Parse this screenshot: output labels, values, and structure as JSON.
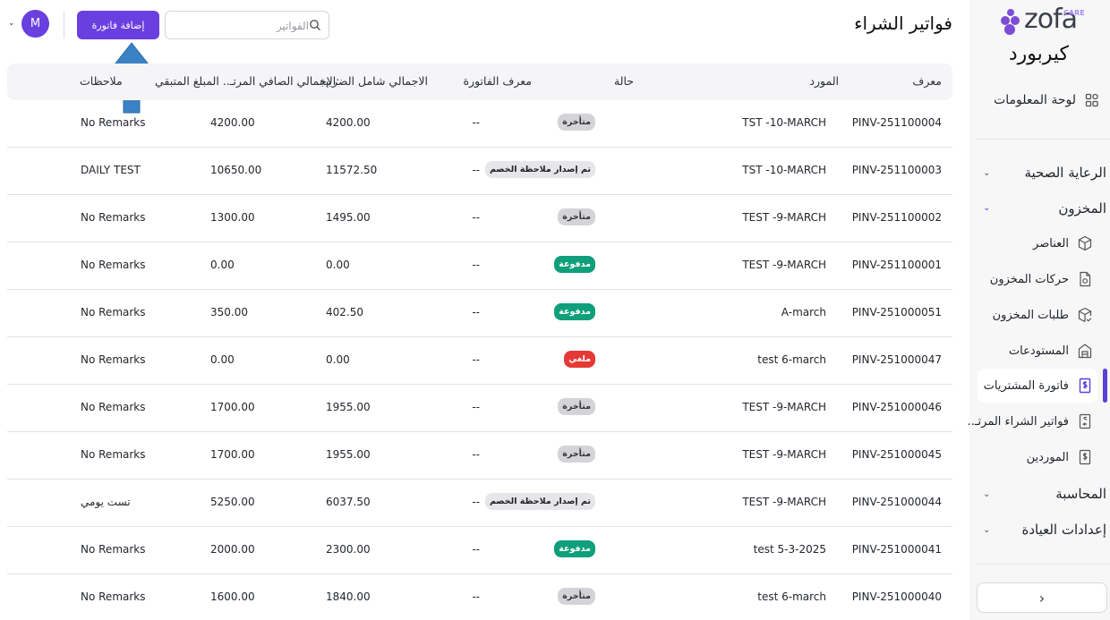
{
  "brand": {
    "logo_text": "zofa",
    "logo_sup": "CARE",
    "clinic": "كيربورد",
    "accent": "#6a3fe0"
  },
  "sidebar": {
    "dashboard": "لوحة المعلومات",
    "sections": [
      {
        "label": "الرعاية الصحية"
      },
      {
        "label": "المخزون"
      },
      {
        "label": "المحاسبة"
      },
      {
        "label": "إعدادات العيادة"
      }
    ],
    "inventory_items": [
      {
        "label": "العناصر",
        "icon": "box-icon"
      },
      {
        "label": "حركات المخزون",
        "icon": "document-icon"
      },
      {
        "label": "طلبات المخزون",
        "icon": "box-check-icon"
      },
      {
        "label": "المستودعات",
        "icon": "warehouse-icon"
      },
      {
        "label": "فاتورة المشتريات",
        "icon": "invoice-icon"
      },
      {
        "label": "فواتير الشراء المرتـ..",
        "icon": "return-invoice-icon"
      },
      {
        "label": "الموردين",
        "icon": "supplier-icon"
      }
    ],
    "active_item": "فاتورة المشتريات"
  },
  "header": {
    "title": "فواتير الشراء",
    "search_placeholder": "الفواتير",
    "add_button": "إضافة فاتورة",
    "avatar_letter": "M"
  },
  "table": {
    "columns": {
      "id": "معرف",
      "supplier": "المورد",
      "status": "حالة",
      "invoice_ref": "معرف الفاتورة",
      "total": "الاجمالي شامل الضريبة",
      "net_remaining": "الإجمالي الصافي المرتـ.. المبلغ المتبقي:",
      "notes": "ملاحظات"
    },
    "rows": [
      {
        "id": "PINV-251100004",
        "supplier": "TST -10-MARCH",
        "status": "متأخرة",
        "status_type": "late",
        "invoice_ref": "--",
        "total": "4200.00",
        "remaining": "4200.00",
        "notes": "No Remarks"
      },
      {
        "id": "PINV-251100003",
        "supplier": "TST -10-MARCH",
        "status": "تم إصدار ملاحظة الخصم",
        "status_type": "credit",
        "invoice_ref": "--",
        "total": "11572.50",
        "remaining": "10650.00",
        "notes": "DAILY TEST"
      },
      {
        "id": "PINV-251100002",
        "supplier": "TEST -9-MARCH",
        "status": "متأخرة",
        "status_type": "late",
        "invoice_ref": "--",
        "total": "1495.00",
        "remaining": "1300.00",
        "notes": "No Remarks"
      },
      {
        "id": "PINV-251100001",
        "supplier": "TEST -9-MARCH",
        "status": "مدفوعة",
        "status_type": "paid",
        "invoice_ref": "--",
        "total": "0.00",
        "remaining": "0.00",
        "notes": "No Remarks"
      },
      {
        "id": "PINV-251000051",
        "supplier": "A-march",
        "status": "مدفوعة",
        "status_type": "paid",
        "invoice_ref": "--",
        "total": "402.50",
        "remaining": "350.00",
        "notes": "No Remarks"
      },
      {
        "id": "PINV-251000047",
        "supplier": "test 6-march",
        "status": "ملغي",
        "status_type": "cancel",
        "invoice_ref": "--",
        "total": "0.00",
        "remaining": "0.00",
        "notes": "No Remarks"
      },
      {
        "id": "PINV-251000046",
        "supplier": "TEST -9-MARCH",
        "status": "متأخرة",
        "status_type": "late",
        "invoice_ref": "--",
        "total": "1955.00",
        "remaining": "1700.00",
        "notes": "No Remarks"
      },
      {
        "id": "PINV-251000045",
        "supplier": "TEST -9-MARCH",
        "status": "متأخرة",
        "status_type": "late",
        "invoice_ref": "--",
        "total": "1955.00",
        "remaining": "1700.00",
        "notes": "No Remarks"
      },
      {
        "id": "PINV-251000044",
        "supplier": "TEST -9-MARCH",
        "status": "تم إصدار ملاحظة الخصم",
        "status_type": "credit",
        "invoice_ref": "--",
        "total": "6037.50",
        "remaining": "5250.00",
        "notes": "تست يومي"
      },
      {
        "id": "PINV-251000041",
        "supplier": "test 5-3-2025",
        "status": "مدفوعة",
        "status_type": "paid",
        "invoice_ref": "--",
        "total": "2300.00",
        "remaining": "2000.00",
        "notes": "No Remarks"
      },
      {
        "id": "PINV-251000040",
        "supplier": "test 6-march",
        "status": "متأخرة",
        "status_type": "late",
        "invoice_ref": "--",
        "total": "1840.00",
        "remaining": "1600.00",
        "notes": "No Remarks"
      }
    ]
  },
  "colors": {
    "paid": "#0f9f7a",
    "cancel": "#e53935",
    "late": "#d4d4d8",
    "credit": "#e6e6ea",
    "arrow": "#3b82c4"
  }
}
